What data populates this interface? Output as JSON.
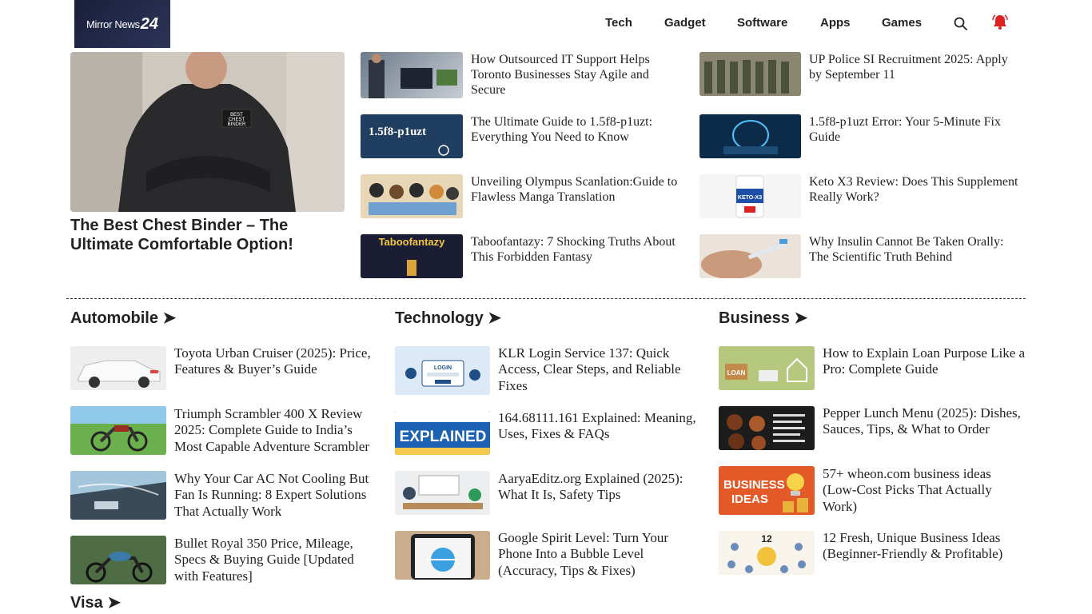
{
  "header": {
    "logo_text": "Mirror News",
    "logo_num": "24",
    "nav": [
      "Tech",
      "Gadget",
      "Software",
      "Apps",
      "Games"
    ]
  },
  "feature": {
    "title": "The Best Chest Binder – The Ultimate Comfortable Option!",
    "badge": "BEST CHEST BINDER"
  },
  "top_col1": [
    {
      "title": "How Outsourced IT Support Helps Toronto Businesses Stay Agile and Secure"
    },
    {
      "title": "The Ultimate Guide to 1.5f8-p1uzt: Everything You Need to Know",
      "thumb_text": "1.5f8-p1uzt"
    },
    {
      "title": "Unveiling Olympus Scanlation:Guide to Flawless Manga Translation"
    },
    {
      "title": "Taboofantazy: 7 Shocking Truths About This Forbidden Fantasy",
      "thumb_text": "Taboofantazy"
    }
  ],
  "top_col2": [
    {
      "title": "UP Police SI Recruitment 2025: Apply by September 11"
    },
    {
      "title": "1.5f8-p1uzt Error: Your 5-Minute Fix Guide"
    },
    {
      "title": "Keto X3 Review: Does This Supplement Really Work?",
      "thumb_text": "KETO-X3"
    },
    {
      "title": "Why Insulin Cannot Be Taken Orally: The Scientific Truth Behind"
    }
  ],
  "sections": [
    {
      "title": "Automobile ➤",
      "items": [
        {
          "title": "Toyota Urban Cruiser (2025): Price, Features & Buyer’s Guide"
        },
        {
          "title": "Triumph Scrambler 400 X Review 2025: Complete Guide to India’s Most Capable Adventure Scrambler"
        },
        {
          "title": "Why Your Car AC Not Cooling But Fan Is Running: 8 Expert Solutions That Actually Work"
        },
        {
          "title": "Bullet Royal 350 Price, Mileage, Specs & Buying Guide [Updated with Features]"
        }
      ]
    },
    {
      "title": "Technology ➤",
      "items": [
        {
          "title": "KLR Login Service 137: Quick Access, Clear Steps, and Reliable Fixes",
          "thumb_text": "LOGIN"
        },
        {
          "title": "164.68111.161 Explained: Meaning, Uses, Fixes & FAQs",
          "thumb_text": "EXPLAINED"
        },
        {
          "title": "AaryaEditz.org Explained (2025): What It Is, Safety Tips"
        },
        {
          "title": "Google Spirit Level: Turn Your Phone Into a Bubble Level (Accuracy, Tips & Fixes)"
        }
      ]
    },
    {
      "title": "Business ➤",
      "items": [
        {
          "title": "How to Explain Loan Purpose Like a Pro: Complete Guide",
          "thumb_text": "LOAN"
        },
        {
          "title": "Pepper Lunch Menu (2025): Dishes, Sauces, Tips, & What to Order"
        },
        {
          "title": "57+ wheon.com business ideas (Low-Cost Picks That Actually Work)",
          "thumb_text": "BUSINESS IDEAS"
        },
        {
          "title": "12 Fresh, Unique Business Ideas (Beginner-Friendly & Profitable)",
          "thumb_text": "12"
        }
      ]
    }
  ],
  "bottom_section": {
    "title": "Visa ➤"
  },
  "colors": {
    "accent": "#e02020",
    "logo_bg": "#1a1f3a",
    "text": "#222222"
  }
}
